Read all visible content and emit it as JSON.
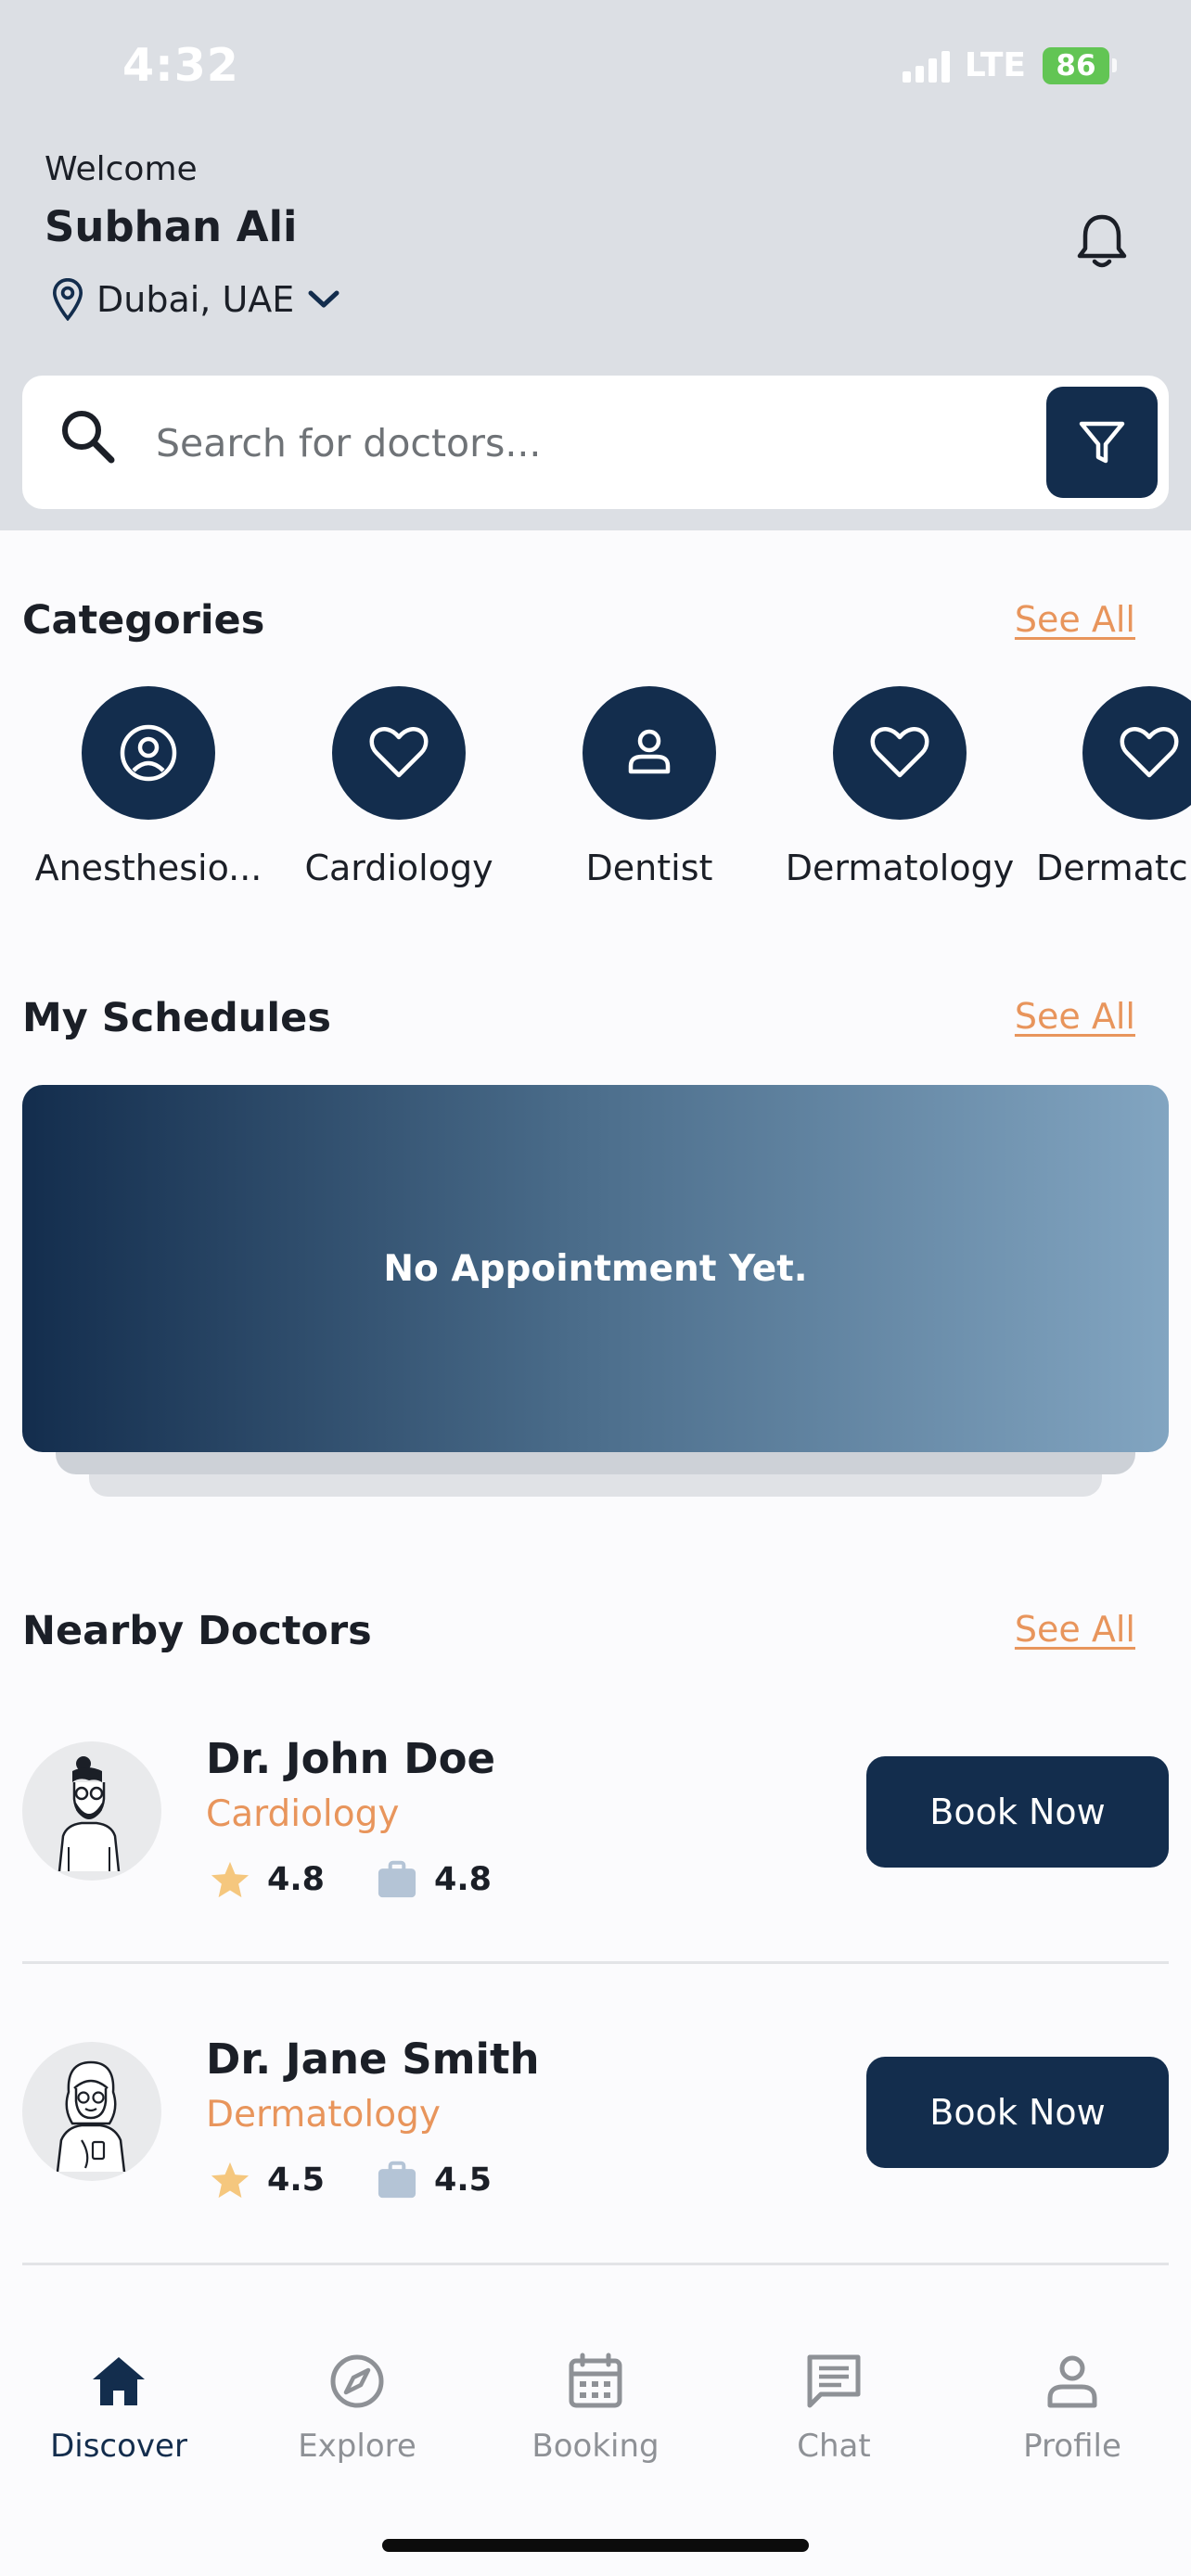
{
  "status_bar": {
    "time": "4:32",
    "network": "LTE",
    "battery": "86"
  },
  "header": {
    "welcome": "Welcome",
    "user_name": "Subhan Ali",
    "location": "Dubai, UAE"
  },
  "search": {
    "placeholder": "Search for doctors..."
  },
  "categories": {
    "title": "Categories",
    "see_all": "See All",
    "items": [
      {
        "label": "Anesthesio...",
        "icon": "user-circle-icon"
      },
      {
        "label": "Cardiology",
        "icon": "heart-icon"
      },
      {
        "label": "Dentist",
        "icon": "person-icon"
      },
      {
        "label": "Dermatology",
        "icon": "heart-icon"
      },
      {
        "label": "Dermatc",
        "icon": "heart-icon"
      }
    ]
  },
  "schedules": {
    "title": "My Schedules",
    "see_all": "See All",
    "empty_text": "No Appointment Yet."
  },
  "nearby": {
    "title": "Nearby Doctors",
    "see_all": "See All",
    "doctors": [
      {
        "name": "Dr. John Doe",
        "specialty": "Cardiology",
        "rating": "4.8",
        "experience": "4.8",
        "book_label": "Book Now"
      },
      {
        "name": "Dr. Jane Smith",
        "specialty": "Dermatology",
        "rating": "4.5",
        "experience": "4.5",
        "book_label": "Book Now"
      }
    ]
  },
  "tabs": [
    {
      "label": "Discover",
      "icon": "home-icon",
      "active": true
    },
    {
      "label": "Explore",
      "icon": "compass-icon",
      "active": false
    },
    {
      "label": "Booking",
      "icon": "calendar-icon",
      "active": false
    },
    {
      "label": "Chat",
      "icon": "chat-icon",
      "active": false
    },
    {
      "label": "Profile",
      "icon": "profile-icon",
      "active": false
    }
  ],
  "colors": {
    "primary": "#132d4d",
    "accent": "#e8955c",
    "header_bg": "#dcdfe4",
    "star": "#f5c77e",
    "briefcase": "#b4c4d6"
  }
}
